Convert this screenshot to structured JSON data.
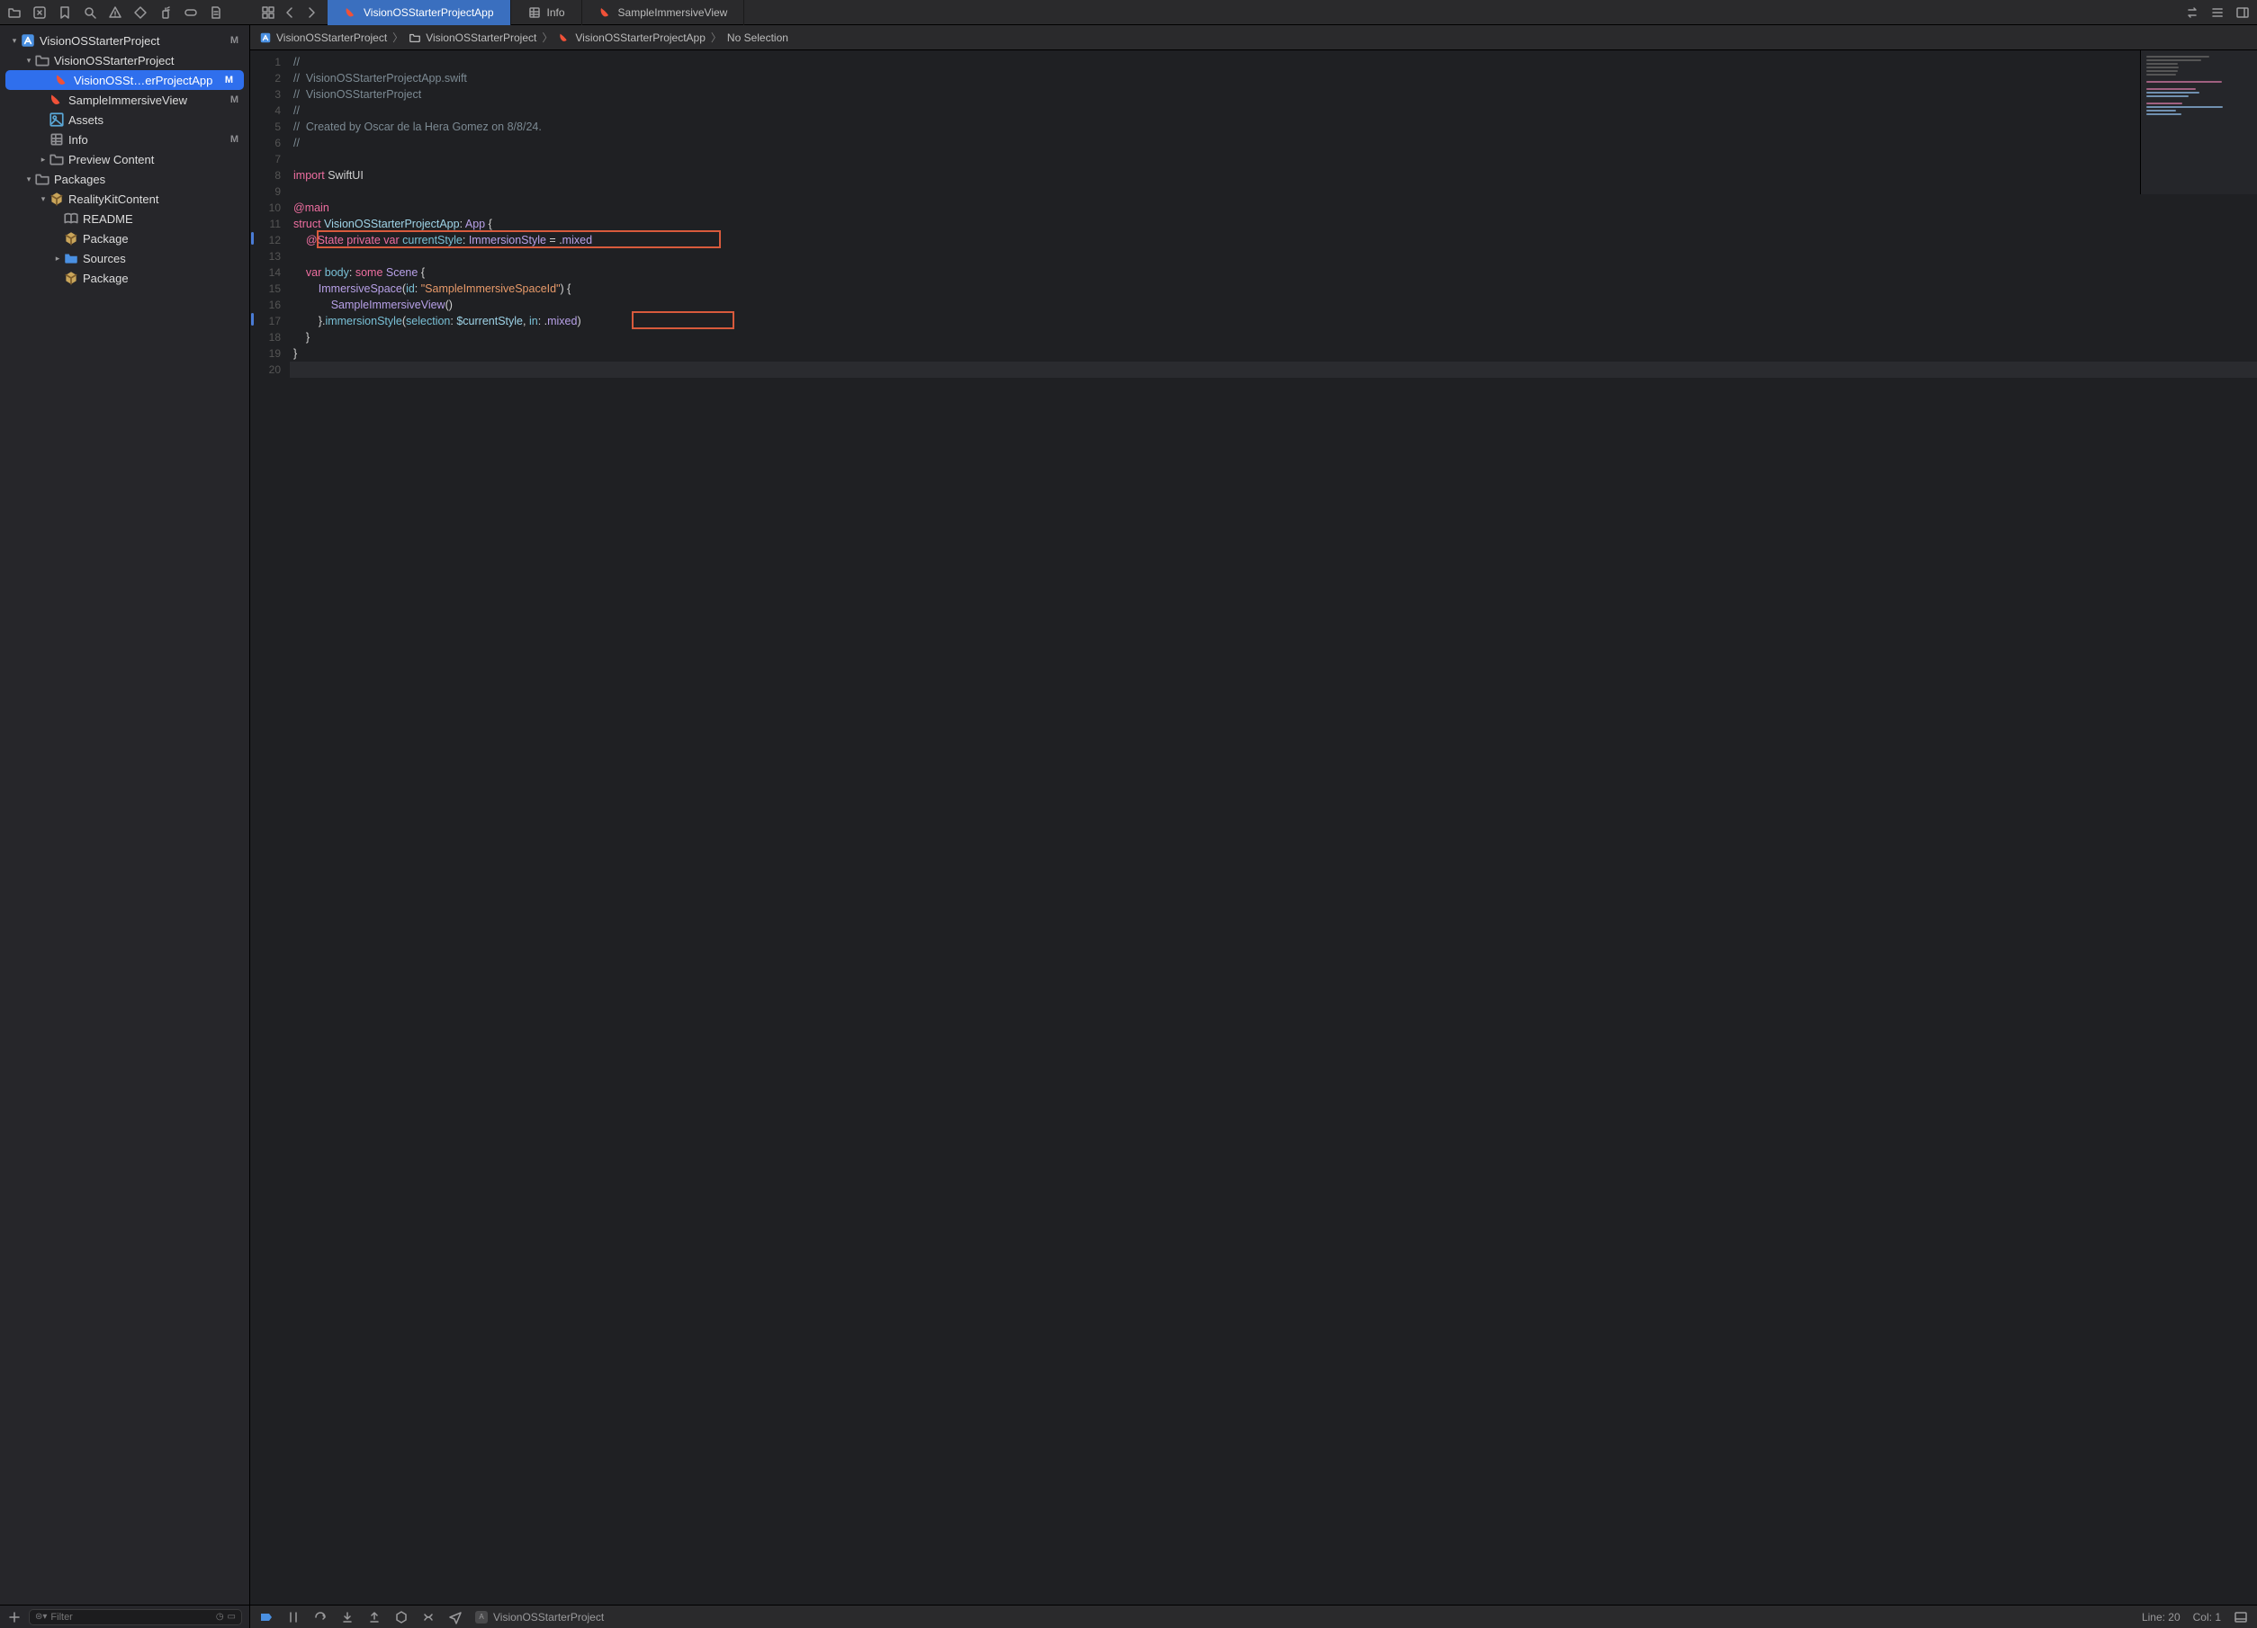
{
  "toolbar": {
    "icons_left": [
      "folder",
      "close-square",
      "bookmark",
      "search",
      "warning",
      "tag",
      "spray",
      "capsule",
      "doc"
    ],
    "icons_right": [
      "swap",
      "list-adjust",
      "panel-right"
    ]
  },
  "tabs": {
    "nav_icons": [
      "grid",
      "chevron-left",
      "chevron-right"
    ],
    "items": [
      {
        "icon": "swift",
        "label": "VisionOSStarterProjectApp",
        "active": true
      },
      {
        "icon": "plist",
        "label": "Info",
        "active": false
      },
      {
        "icon": "swift",
        "label": "SampleImmersiveView",
        "active": false
      }
    ]
  },
  "sidebar": {
    "tree": [
      {
        "depth": 0,
        "disclosure": "down",
        "icon": "proj",
        "label": "VisionOSStarterProject",
        "badge": "M"
      },
      {
        "depth": 1,
        "disclosure": "down",
        "icon": "folder",
        "label": "VisionOSStarterProject",
        "badge": ""
      },
      {
        "depth": 2,
        "disclosure": "",
        "icon": "swift",
        "label": "VisionOSSt…erProjectApp",
        "badge": "M",
        "selected": true
      },
      {
        "depth": 2,
        "disclosure": "",
        "icon": "swift",
        "label": "SampleImmersiveView",
        "badge": "M"
      },
      {
        "depth": 2,
        "disclosure": "",
        "icon": "assets",
        "label": "Assets",
        "badge": ""
      },
      {
        "depth": 2,
        "disclosure": "",
        "icon": "plist",
        "label": "Info",
        "badge": "M"
      },
      {
        "depth": 2,
        "disclosure": "right",
        "icon": "folder",
        "label": "Preview Content",
        "badge": ""
      },
      {
        "depth": 1,
        "disclosure": "down",
        "icon": "folder",
        "label": "Packages",
        "badge": ""
      },
      {
        "depth": 2,
        "disclosure": "down",
        "icon": "pkg",
        "label": "RealityKitContent",
        "badge": ""
      },
      {
        "depth": 3,
        "disclosure": "",
        "icon": "readme",
        "label": "README",
        "badge": ""
      },
      {
        "depth": 3,
        "disclosure": "",
        "icon": "pkg",
        "label": "Package",
        "badge": ""
      },
      {
        "depth": 3,
        "disclosure": "right",
        "icon": "folder-blue",
        "label": "Sources",
        "badge": ""
      },
      {
        "depth": 3,
        "disclosure": "",
        "icon": "pkg",
        "label": "Package",
        "badge": ""
      }
    ],
    "filter_placeholder": "Filter"
  },
  "jumpbar": {
    "crumbs": [
      {
        "icon": "proj",
        "label": "VisionOSStarterProject"
      },
      {
        "icon": "folder",
        "label": "VisionOSStarterProject"
      },
      {
        "icon": "swift",
        "label": "VisionOSStarterProjectApp"
      },
      {
        "icon": "",
        "label": "No Selection"
      }
    ]
  },
  "editor": {
    "lines": [
      {
        "n": 1,
        "tokens": [
          {
            "c": "c-comment",
            "t": "//"
          }
        ]
      },
      {
        "n": 2,
        "tokens": [
          {
            "c": "c-comment",
            "t": "//  VisionOSStarterProjectApp.swift"
          }
        ]
      },
      {
        "n": 3,
        "tokens": [
          {
            "c": "c-comment",
            "t": "//  VisionOSStarterProject"
          }
        ]
      },
      {
        "n": 4,
        "tokens": [
          {
            "c": "c-comment",
            "t": "//"
          }
        ]
      },
      {
        "n": 5,
        "tokens": [
          {
            "c": "c-comment",
            "t": "//  Created by Oscar de la Hera Gomez on 8/8/24."
          }
        ]
      },
      {
        "n": 6,
        "tokens": [
          {
            "c": "c-comment",
            "t": "//"
          }
        ]
      },
      {
        "n": 7,
        "tokens": [
          {
            "c": "",
            "t": ""
          }
        ]
      },
      {
        "n": 8,
        "tokens": [
          {
            "c": "c-keyword",
            "t": "import"
          },
          {
            "c": "",
            "t": " SwiftUI"
          }
        ]
      },
      {
        "n": 9,
        "tokens": [
          {
            "c": "",
            "t": ""
          }
        ]
      },
      {
        "n": 10,
        "tokens": [
          {
            "c": "c-attr",
            "t": "@main"
          }
        ]
      },
      {
        "n": 11,
        "tokens": [
          {
            "c": "c-keyword",
            "t": "struct"
          },
          {
            "c": "",
            "t": " "
          },
          {
            "c": "c-ident",
            "t": "VisionOSStarterProjectApp"
          },
          {
            "c": "",
            "t": ": "
          },
          {
            "c": "c-type",
            "t": "App"
          },
          {
            "c": "",
            "t": " {"
          }
        ]
      },
      {
        "n": 12,
        "tokens": [
          {
            "c": "",
            "t": "    "
          },
          {
            "c": "c-attr",
            "t": "@State"
          },
          {
            "c": "",
            "t": " "
          },
          {
            "c": "c-keyword",
            "t": "private"
          },
          {
            "c": "",
            "t": " "
          },
          {
            "c": "c-keyword",
            "t": "var"
          },
          {
            "c": "",
            "t": " "
          },
          {
            "c": "c-var",
            "t": "currentStyle"
          },
          {
            "c": "",
            "t": ": "
          },
          {
            "c": "c-type",
            "t": "ImmersionStyle"
          },
          {
            "c": "",
            "t": " = ."
          },
          {
            "c": "c-enum",
            "t": "mixed"
          }
        ]
      },
      {
        "n": 13,
        "tokens": [
          {
            "c": "",
            "t": "    "
          }
        ]
      },
      {
        "n": 14,
        "tokens": [
          {
            "c": "",
            "t": "    "
          },
          {
            "c": "c-keyword",
            "t": "var"
          },
          {
            "c": "",
            "t": " "
          },
          {
            "c": "c-prop",
            "t": "body"
          },
          {
            "c": "",
            "t": ": "
          },
          {
            "c": "c-keyword",
            "t": "some"
          },
          {
            "c": "",
            "t": " "
          },
          {
            "c": "c-type",
            "t": "Scene"
          },
          {
            "c": "",
            "t": " {"
          }
        ]
      },
      {
        "n": 15,
        "tokens": [
          {
            "c": "",
            "t": "        "
          },
          {
            "c": "c-type",
            "t": "ImmersiveSpace"
          },
          {
            "c": "",
            "t": "("
          },
          {
            "c": "c-param",
            "t": "id"
          },
          {
            "c": "",
            "t": ": "
          },
          {
            "c": "c-string",
            "t": "\"SampleImmersiveSpaceId\""
          },
          {
            "c": "",
            "t": ") {"
          }
        ]
      },
      {
        "n": 16,
        "tokens": [
          {
            "c": "",
            "t": "            "
          },
          {
            "c": "c-type",
            "t": "SampleImmersiveView"
          },
          {
            "c": "",
            "t": "()"
          }
        ]
      },
      {
        "n": 17,
        "tokens": [
          {
            "c": "",
            "t": "        }."
          },
          {
            "c": "c-func",
            "t": "immersionStyle"
          },
          {
            "c": "",
            "t": "("
          },
          {
            "c": "c-param",
            "t": "selection"
          },
          {
            "c": "",
            "t": ": "
          },
          {
            "c": "c-ident",
            "t": "$currentStyle"
          },
          {
            "c": "",
            "t": ", "
          },
          {
            "c": "c-param",
            "t": "in"
          },
          {
            "c": "",
            "t": ": ."
          },
          {
            "c": "c-enum",
            "t": "mixed"
          },
          {
            "c": "",
            "t": ")"
          }
        ]
      },
      {
        "n": 18,
        "tokens": [
          {
            "c": "",
            "t": "    }"
          }
        ]
      },
      {
        "n": 19,
        "tokens": [
          {
            "c": "",
            "t": "}"
          }
        ]
      },
      {
        "n": 20,
        "tokens": [
          {
            "c": "",
            "t": ""
          }
        ],
        "cursor": true
      }
    ],
    "change_bars": [
      {
        "from": 12,
        "to": 12
      },
      {
        "from": 17,
        "to": 17
      }
    ],
    "highlights": [
      {
        "line": 12,
        "col_from": 4,
        "col_to": 62
      },
      {
        "line": 17,
        "col_from": 50,
        "col_to": 64
      }
    ]
  },
  "debug_bar": {
    "scheme": "VisionOSStarterProject",
    "line": "Line: 20",
    "col": "Col: 1"
  }
}
